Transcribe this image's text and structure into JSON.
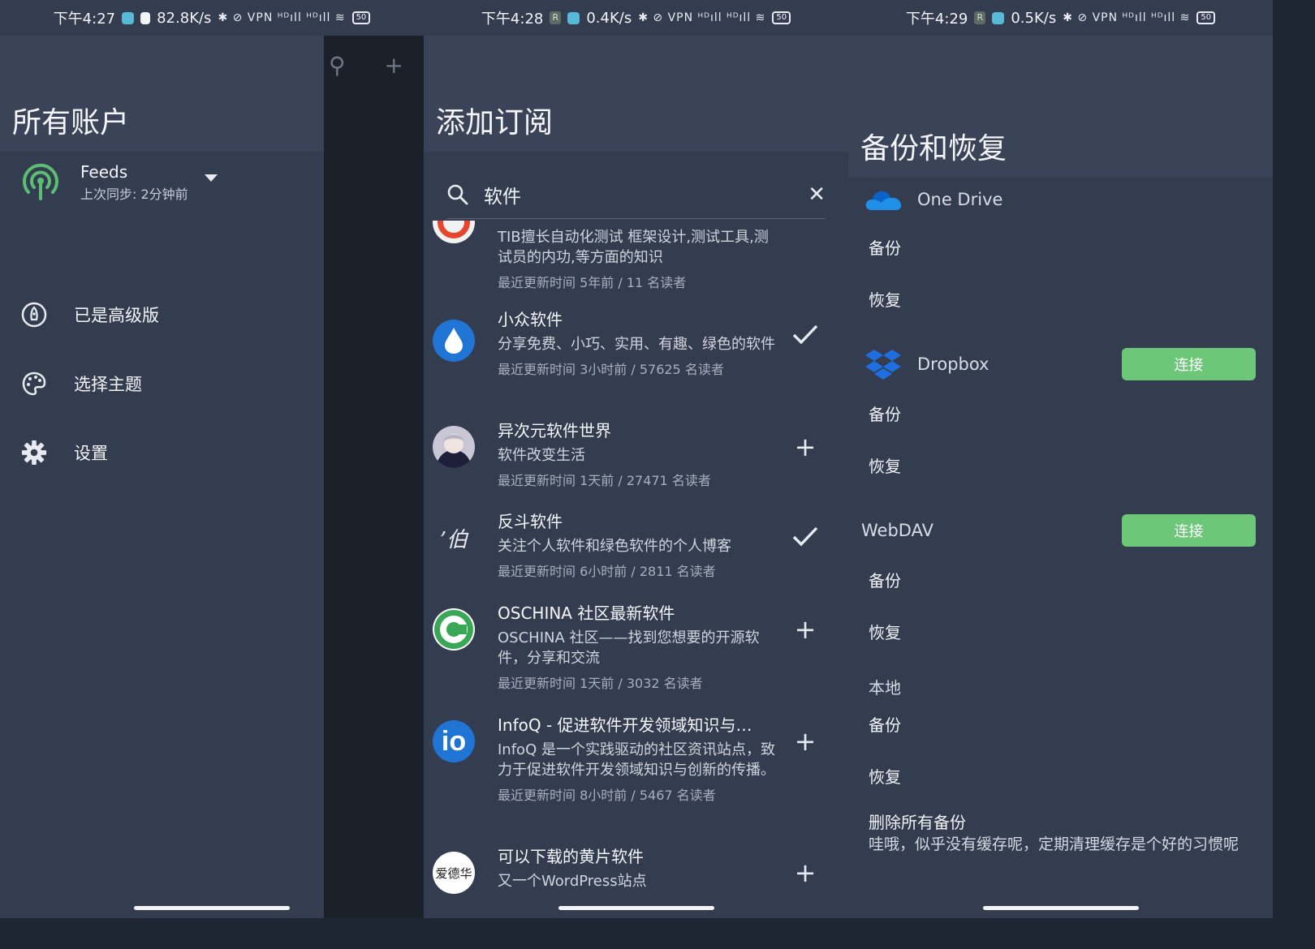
{
  "screens": [
    {
      "status": {
        "time": "下午4:27",
        "speed": "82.8K/s",
        "battery": "50",
        "icons": "✱ ⊘ VPN ᴴᴰıll ᴴᴰıll ≋"
      },
      "drawer": {
        "title": "所有账户",
        "account": {
          "name": "Feeds",
          "sync": "上次同步: 2分钟前"
        },
        "menu": [
          {
            "label": "已是高级版",
            "icon": "rocket-icon"
          },
          {
            "label": "选择主题",
            "icon": "palette-icon"
          },
          {
            "label": "设置",
            "icon": "gear-icon"
          }
        ]
      }
    },
    {
      "status": {
        "time": "下午4:28",
        "badge": "R",
        "speed": "0.4K/s",
        "battery": "50",
        "icons": "✱ ⊘ VPN ᴴᴰıll ᴴᴰıll ≋"
      },
      "title": "添加订阅",
      "search": {
        "value": "软件"
      },
      "feeds": [
        {
          "title": "",
          "desc": "TIB擅长自动化测试  框架设计,测试工具,测试员的内功,等方面的知识",
          "meta": "最近更新时间 5年前 / 11 名读者",
          "action": ""
        },
        {
          "title": "小众软件",
          "desc": "分享免费、小巧、实用、有趣、绿色的软件",
          "meta": "最近更新时间 3小时前 / 57625 名读者",
          "action": "check"
        },
        {
          "title": "异次元软件世界",
          "desc": "软件改变生活",
          "meta": "最近更新时间 1天前 / 27471 名读者",
          "action": "add"
        },
        {
          "title": "反斗软件",
          "desc": "关注个人软件和绿色软件的个人博客",
          "meta": "最近更新时间 6小时前 / 2811 名读者",
          "action": "check",
          "avatar_text": "’伯"
        },
        {
          "title": "OSCHINA 社区最新软件",
          "desc": "OSCHINA 社区——找到您想要的开源软件，分享和交流",
          "meta": "最近更新时间 1天前 / 3032 名读者",
          "action": "add"
        },
        {
          "title": "InfoQ - 促进软件开发领域知识与…",
          "desc": "InfoQ 是一个实践驱动的社区资讯站点，致力于促进软件开发领域知识与创新的传播。",
          "meta": "最近更新时间 8小时前 / 5467 名读者",
          "action": "add",
          "avatar_text": "io"
        },
        {
          "title": "可以下载的黄片软件",
          "desc": "又一个WordPress站点",
          "meta": "",
          "action": "add",
          "avatar_text": "爱德华"
        }
      ]
    },
    {
      "status": {
        "time": "下午4:29",
        "badge": "R",
        "speed": "0.5K/s",
        "battery": "50",
        "icons": "✱ ⊘ VPN ᴴᴰıll ᴴᴰıll ≋"
      },
      "title": "备份和恢复",
      "onedrive": {
        "label": "One Drive",
        "backup": "备份",
        "restore": "恢复"
      },
      "dropbox": {
        "label": "Dropbox",
        "connect": "连接",
        "backup": "备份",
        "restore": "恢复"
      },
      "webdav": {
        "label": "WebDAV",
        "connect": "连接",
        "backup": "备份",
        "restore": "恢复"
      },
      "local": {
        "label": "本地",
        "backup": "备份",
        "restore": "恢复"
      },
      "delete": {
        "title": "删除所有备份",
        "desc": "哇哦，似乎没有缓存呢，定期清理缓存是个好的习惯呢"
      }
    }
  ],
  "colors": {
    "appbar": "#3a4357",
    "background": "#343c4f",
    "connect": "#6cc779",
    "feedsIcon": "#5bbf73"
  }
}
